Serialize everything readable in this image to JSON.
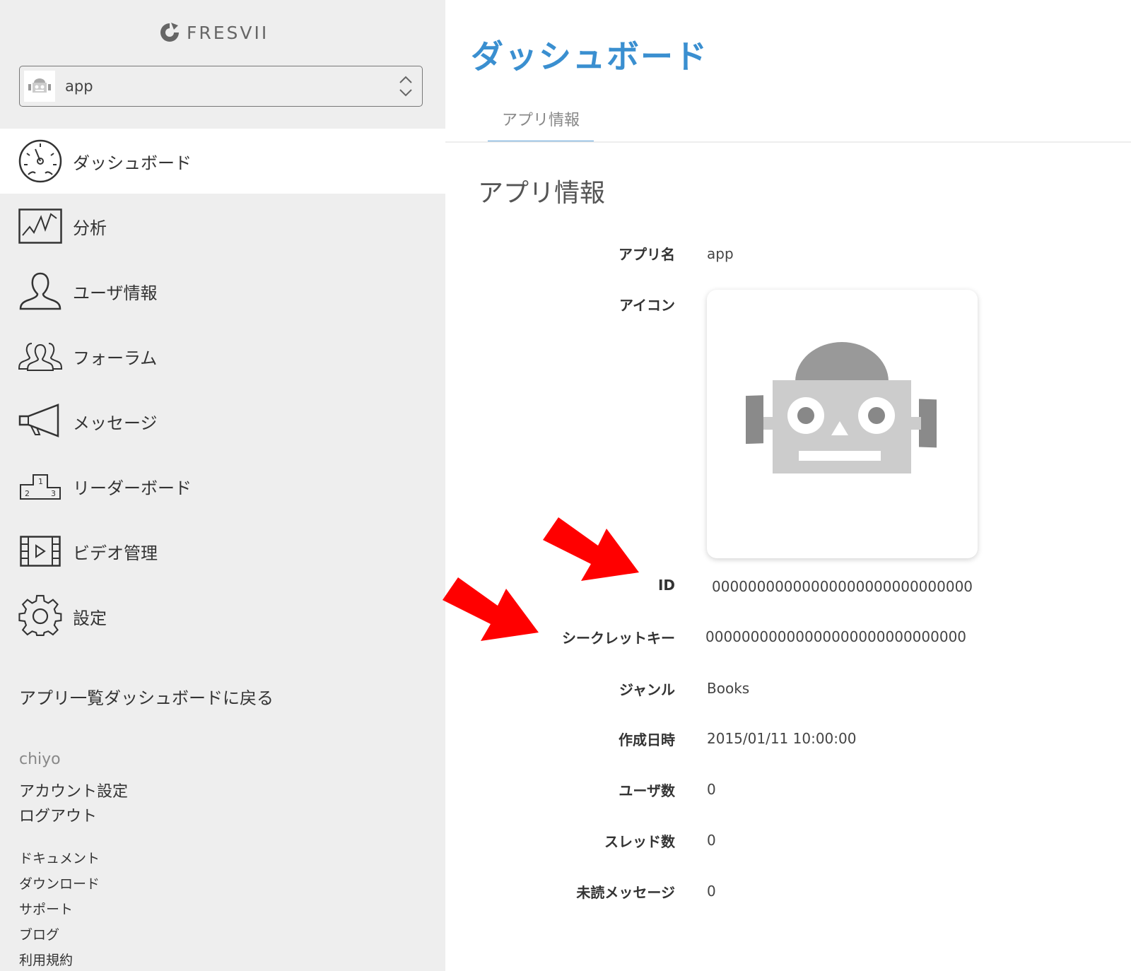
{
  "brand": {
    "name": "FRESVII"
  },
  "app_selector": {
    "value": "app"
  },
  "nav": {
    "items": [
      {
        "label": "ダッシュボード",
        "icon": "gauge-icon",
        "active": true
      },
      {
        "label": "分析",
        "icon": "chart-line-icon"
      },
      {
        "label": "ユーザ情報",
        "icon": "user-icon"
      },
      {
        "label": "フォーラム",
        "icon": "users-group-icon"
      },
      {
        "label": "メッセージ",
        "icon": "megaphone-icon"
      },
      {
        "label": "リーダーボード",
        "icon": "podium-icon"
      },
      {
        "label": "ビデオ管理",
        "icon": "film-icon"
      },
      {
        "label": "設定",
        "icon": "gear-icon"
      }
    ],
    "back_link": "アプリ一覧ダッシュボードに戻る"
  },
  "account": {
    "username": "chiyo",
    "settings": "アカウント設定",
    "logout": "ログアウト"
  },
  "footer_links": [
    "ドキュメント",
    "ダウンロード",
    "サポート",
    "ブログ",
    "利用規約"
  ],
  "page": {
    "title": "ダッシュボード",
    "tab": "アプリ情報",
    "section_title": "アプリ情報"
  },
  "app_info": {
    "name_label": "アプリ名",
    "name": "app",
    "icon_label": "アイコン",
    "id_label": "ID",
    "id": "00000000000000000000000000000",
    "secret_label": "シークレットキー",
    "secret": "00000000000000000000000000000",
    "genre_label": "ジャンル",
    "genre": "Books",
    "created_label": "作成日時",
    "created": "2015/01/11 10:00:00",
    "users_label": "ユーザ数",
    "users": "0",
    "threads_label": "スレッド数",
    "threads": "0",
    "unread_label": "未読メッセージ",
    "unread": "0"
  },
  "colors": {
    "accent": "#3a8fd0",
    "sidebar_bg": "#eeeeee",
    "annotation_arrow": "#ff0000"
  }
}
